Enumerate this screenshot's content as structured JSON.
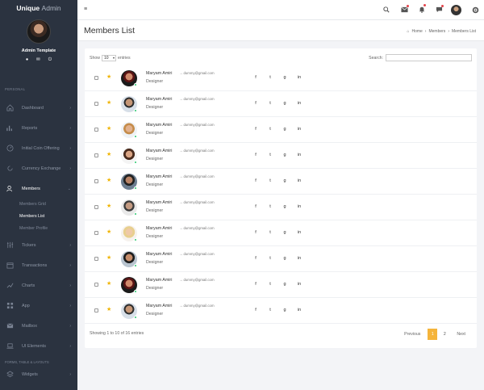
{
  "brand": {
    "bold": "Unique",
    "thin": "Admin"
  },
  "profile": {
    "name": "Admin Template",
    "icons": [
      "user-icon",
      "mail-icon",
      "power-icon"
    ]
  },
  "sidebar": {
    "section1": "PERSONAL",
    "items": [
      {
        "label": "Dashboard",
        "icon": "home-icon"
      },
      {
        "label": "Reports",
        "icon": "bar-chart-icon"
      },
      {
        "label": "Initial Coin Offering",
        "icon": "gauge-icon"
      },
      {
        "label": "Currency Exchange",
        "icon": "refresh-icon"
      },
      {
        "label": "Members",
        "icon": "users-icon"
      }
    ],
    "sub": [
      "Members Grid",
      "Members List",
      "Member Profile"
    ],
    "items2": [
      {
        "label": "Tickers",
        "icon": "sliders-icon"
      },
      {
        "label": "Transactions",
        "icon": "calendar-icon"
      },
      {
        "label": "Charts",
        "icon": "line-chart-icon"
      },
      {
        "label": "App",
        "icon": "grid-icon"
      },
      {
        "label": "Mailbox",
        "icon": "mail-icon"
      },
      {
        "label": "UI Elements",
        "icon": "laptop-icon"
      }
    ],
    "section2": "FORMS, TABLE & LAYOUTS",
    "items3": [
      {
        "label": "Widgets",
        "icon": "layers-icon"
      }
    ]
  },
  "header": {
    "title": "Members List",
    "breadcrumb": [
      "Home",
      "Members",
      "Members List"
    ]
  },
  "table": {
    "show_label": "Show",
    "entries_value": "10",
    "entries_label": "entries",
    "search_label": "Search:",
    "search_value": "",
    "rows": [
      {
        "name": "Maryam Amiri",
        "email": "dummy@gmail.com",
        "role": "Designer",
        "starred": true
      },
      {
        "name": "Maryam Amiri",
        "email": "dummy@gmail.com",
        "role": "Designer",
        "starred": true
      },
      {
        "name": "Maryam Amiri",
        "email": "dummy@gmail.com",
        "role": "Designer",
        "starred": true
      },
      {
        "name": "Maryam Amiri",
        "email": "dummy@gmail.com",
        "role": "Designer",
        "starred": true
      },
      {
        "name": "Maryam Amiri",
        "email": "dummy@gmail.com",
        "role": "Designer",
        "starred": true
      },
      {
        "name": "Maryam Amiri",
        "email": "dummy@gmail.com",
        "role": "Designer",
        "starred": true
      },
      {
        "name": "Maryam Amiri",
        "email": "dummy@gmail.com",
        "role": "Designer",
        "starred": true
      },
      {
        "name": "Maryam Amiri",
        "email": "dummy@gmail.com",
        "role": "Designer",
        "starred": true
      },
      {
        "name": "Maryam Amiri",
        "email": "dummy@gmail.com",
        "role": "Designer",
        "starred": true
      },
      {
        "name": "Maryam Amiri",
        "email": "dummy@gmail.com",
        "role": "Designer",
        "starred": true
      }
    ],
    "social": [
      "f",
      "t",
      "g",
      "in"
    ],
    "info": "Showing 1 to 10 of 16 entries",
    "pagination": {
      "prev": "Previous",
      "pages": [
        "1",
        "2"
      ],
      "current": "1",
      "next": "Next"
    }
  },
  "colors": {
    "sidebar": "#2b3340",
    "accent": "#f5b43b",
    "star": "#f0b400",
    "online": "#28c76f"
  }
}
